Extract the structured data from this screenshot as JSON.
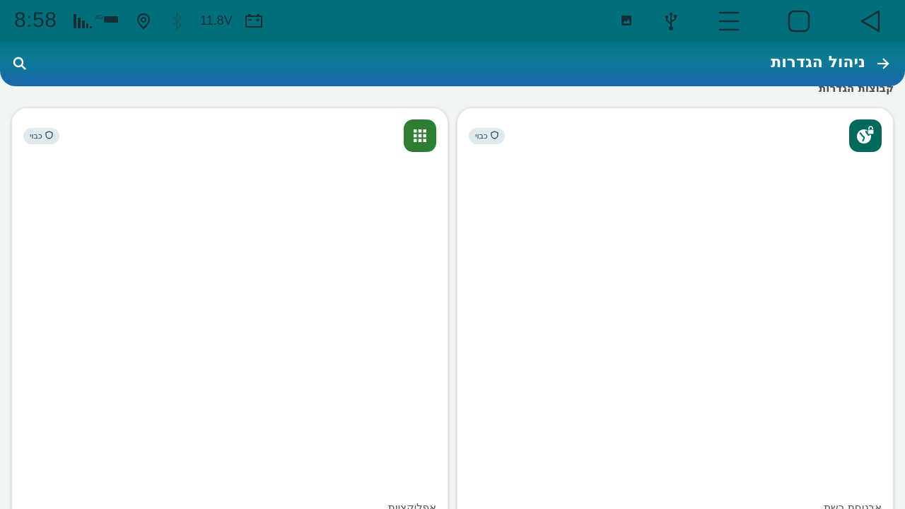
{
  "status_bar": {
    "time": "8:58",
    "network_tag": "4G",
    "voltage": "11.8V",
    "icons": [
      "signal-icon",
      "location-icon",
      "bluetooth-icon",
      "battery-icon",
      "image-icon",
      "usb-icon",
      "menu-icon",
      "home-icon",
      "back-nav-icon"
    ]
  },
  "app_bar": {
    "title": "ניהול הגדרות",
    "back_icon": "arrow-right-icon",
    "search_icon": "search-icon"
  },
  "section": {
    "title": "קבוצות הגדרות"
  },
  "cards": [
    {
      "id": "right",
      "icon": "globe-lock-icon",
      "icon_color": "#00695c",
      "badge": "כבוי",
      "footer": "אבטחת רשת"
    },
    {
      "id": "left",
      "icon": "apps-grid-icon",
      "icon_color": "#2e7d32",
      "badge": "כבוי",
      "footer": "אפליקציות"
    }
  ],
  "colors": {
    "status_bar": "#006f7b",
    "app_bar_top": "#007584",
    "app_bar_bottom": "#1b67ad",
    "background": "#f1f5f6"
  }
}
